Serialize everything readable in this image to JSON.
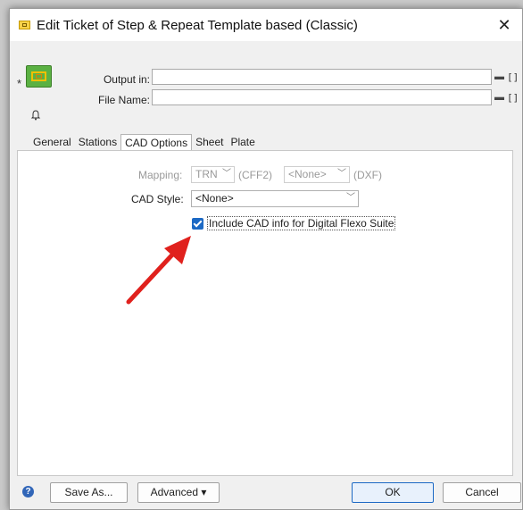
{
  "window": {
    "title": "Edit Ticket of Step & Repeat Template based (Classic)",
    "close_glyph": "✕"
  },
  "header": {
    "output_label": "Output in:",
    "output_value": "",
    "filename_label": "File Name:",
    "filename_value": "",
    "folder_glyph": "▬",
    "bracket_glyph": "[]"
  },
  "tabs": [
    "General",
    "Stations",
    "CAD Options",
    "Sheet",
    "Plate"
  ],
  "active_tab": "CAD Options",
  "cad": {
    "mapping_label": "Mapping:",
    "mapping_value": "TRN",
    "mapping_suffix": "(CFF2)",
    "mapping2_value": "<None>",
    "mapping2_suffix": "(DXF)",
    "style_label": "CAD Style:",
    "style_value": "<None>",
    "include_label": "Include CAD info for Digital Flexo Suite",
    "include_checked": true
  },
  "footer": {
    "help_glyph": "?",
    "save_as": "Save As...",
    "advanced": "Advanced ▾",
    "ok": "OK",
    "cancel": "Cancel"
  },
  "colors": {
    "accent": "#1c69c4",
    "annotation_arrow": "#e0211d"
  },
  "icons": [
    "ticket-icon",
    "template-icon",
    "bell-icon",
    "folder-icon",
    "help-icon",
    "chevron-down-icon"
  ]
}
